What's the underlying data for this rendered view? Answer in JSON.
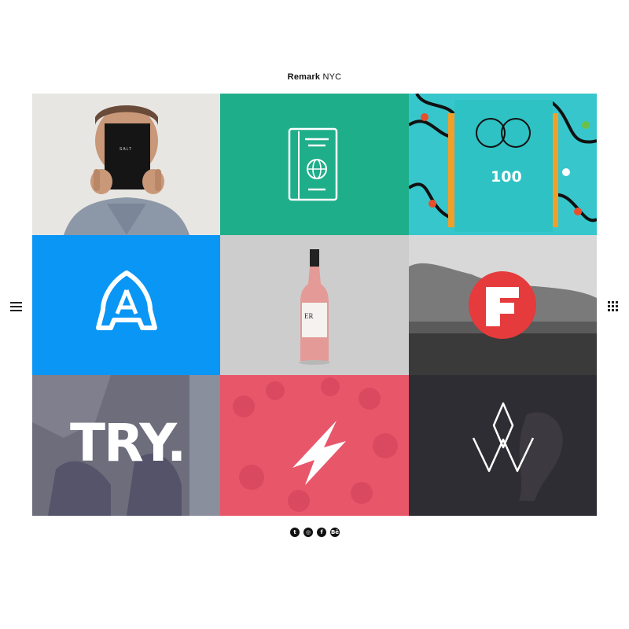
{
  "header": {
    "brand_bold": "Remark",
    "brand_rest": " NYC"
  },
  "nav": {
    "menu_icon": "hamburger-icon",
    "grid_icon": "grid-dots-icon"
  },
  "tiles": [
    {
      "id": "salt",
      "text": "SALT",
      "bg": "#e4e3df"
    },
    {
      "id": "passport",
      "icon": "passport-icon",
      "bg": "#1fae8a"
    },
    {
      "id": "hundred",
      "text": "100",
      "bg": "#36c5cc"
    },
    {
      "id": "a-logo",
      "icon": "a-letter-logo",
      "bg": "#0a96f5"
    },
    {
      "id": "wine",
      "text": "ER",
      "bg": "#cfcfcf"
    },
    {
      "id": "f-logo",
      "icon": "f-letter-logo",
      "bg": "#5c5c5c",
      "accent": "#e63c3c"
    },
    {
      "id": "try",
      "text": "TRY.",
      "bg": "#6b6a78"
    },
    {
      "id": "bolt",
      "icon": "bolt-logo",
      "bg": "#e9566b"
    },
    {
      "id": "wolf",
      "icon": "w-diamond-logo",
      "bg": "#2d2c31"
    }
  ],
  "social": [
    {
      "name": "twitter-icon",
      "glyph": "t"
    },
    {
      "name": "dribbble-icon",
      "glyph": "◎"
    },
    {
      "name": "facebook-icon",
      "glyph": "f"
    },
    {
      "name": "behance-icon",
      "glyph": "Bē"
    }
  ]
}
